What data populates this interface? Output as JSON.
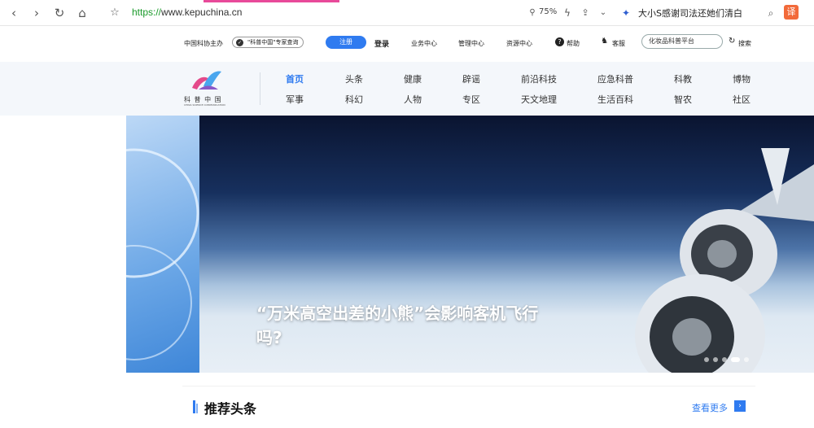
{
  "browser": {
    "url_scheme": "https://",
    "url_rest": "www.kepuchina.cn",
    "zoom": "75%",
    "hot_search": "大小S感谢司法还她们清白",
    "translate_label": "译"
  },
  "util": {
    "sponsor": "中国科协主办",
    "expert_check": "\"科普中国\"专家查询",
    "register": "注册",
    "login": "登录",
    "business": "业务中心",
    "manage": "管理中心",
    "resources": "资源中心",
    "help": "帮助",
    "service": "客服",
    "search_placeholder": "化妆品科普平台",
    "search_btn": "搜索"
  },
  "logo": {
    "cn": "科 普 中 国",
    "en": "CHINA SCIENCE COMMUNICATION"
  },
  "nav": {
    "row1": [
      "首页",
      "头条",
      "健康",
      "辟谣",
      "前沿科技",
      "应急科普",
      "科教",
      "博物"
    ],
    "row2": [
      "军事",
      "科幻",
      "人物",
      "专区",
      "天文地理",
      "生活百科",
      "智农",
      "社区"
    ]
  },
  "hero": {
    "title": "“万米高空出差的小熊”会影响客机飞行吗?"
  },
  "recommend": {
    "title": "推荐头条",
    "more": "查看更多"
  },
  "colors": {
    "accent": "#2f7bf0",
    "url_green": "#1a9a2a"
  }
}
